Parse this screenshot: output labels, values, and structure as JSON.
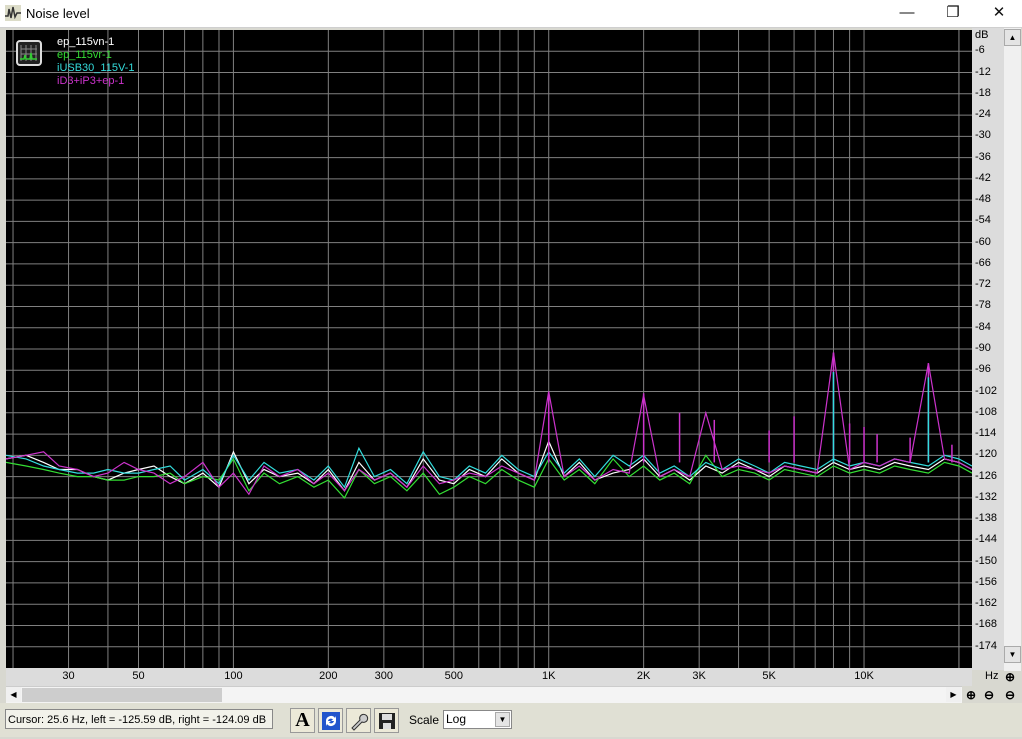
{
  "window": {
    "title": "Noise level",
    "icon": "waveform-app-icon",
    "minimize": "—",
    "restore": "❐",
    "close": "✕"
  },
  "legend": [
    {
      "name": "ep_115vn-1",
      "color": "#ffffff"
    },
    {
      "name": "ep_115vr-1",
      "color": "#33dd33"
    },
    {
      "name": "iUSB30_115V-1",
      "color": "#33dddd"
    },
    {
      "name": "iD3+iP3+ep-1",
      "color": "#cc33cc"
    }
  ],
  "chart_data": {
    "type": "line",
    "xscale": "log",
    "xlim": [
      19,
      22000
    ],
    "ylim": [
      -180,
      0
    ],
    "grid": true,
    "background": "#000000",
    "grid_color": "#808080",
    "ylabel": "dB",
    "xlabel": "Hz",
    "yticks": [
      -6,
      -12,
      -18,
      -24,
      -30,
      -36,
      -42,
      -48,
      -54,
      -60,
      -66,
      -72,
      -78,
      -84,
      -90,
      -96,
      -102,
      -108,
      -114,
      -120,
      -126,
      -132,
      -138,
      -144,
      -150,
      -156,
      -162,
      -168,
      -174
    ],
    "xticks": [
      {
        "v": 30,
        "label": "30"
      },
      {
        "v": 50,
        "label": "50"
      },
      {
        "v": 100,
        "label": "100"
      },
      {
        "v": 200,
        "label": "200"
      },
      {
        "v": 300,
        "label": "300"
      },
      {
        "v": 500,
        "label": "500"
      },
      {
        "v": 1000,
        "label": "1K"
      },
      {
        "v": 2000,
        "label": "2K"
      },
      {
        "v": 3000,
        "label": "3K"
      },
      {
        "v": 5000,
        "label": "5K"
      },
      {
        "v": 10000,
        "label": "10K"
      }
    ],
    "x": [
      19,
      22,
      25,
      28,
      32,
      36,
      40,
      45,
      50,
      56,
      63,
      70,
      80,
      90,
      100,
      112,
      125,
      140,
      160,
      180,
      200,
      225,
      250,
      280,
      315,
      355,
      400,
      450,
      500,
      560,
      630,
      710,
      800,
      900,
      1000,
      1120,
      1250,
      1400,
      1600,
      1800,
      2000,
      2250,
      2500,
      2800,
      3150,
      3550,
      4000,
      4500,
      5000,
      5600,
      6300,
      7100,
      8000,
      9000,
      10000,
      11200,
      12500,
      14000,
      16000,
      18000,
      20000,
      22000
    ],
    "series": [
      {
        "name": "ep_115vn-1",
        "color": "#ffffff",
        "values": [
          -121,
          -120,
          -122,
          -124,
          -124,
          -126,
          -127,
          -125,
          -124,
          -123,
          -126,
          -128,
          -125,
          -129,
          -119,
          -128,
          -124,
          -126,
          -125,
          -128,
          -124,
          -130,
          -122,
          -127,
          -125,
          -129,
          -121,
          -127,
          -128,
          -124,
          -126,
          -121,
          -125,
          -127,
          -116,
          -126,
          -122,
          -127,
          -125,
          -124,
          -121,
          -126,
          -124,
          -127,
          -123,
          -125,
          -122,
          -124,
          -126,
          -123,
          -124,
          -125,
          -122,
          -124,
          -123,
          -124,
          -122,
          -123,
          -124,
          -121,
          -122,
          -124
        ]
      },
      {
        "name": "ep_115vr-1",
        "color": "#33dd33",
        "values": [
          -122,
          -123,
          -124,
          -125,
          -126,
          -126,
          -127,
          -127,
          -126,
          -126,
          -125,
          -128,
          -126,
          -127,
          -121,
          -130,
          -125,
          -128,
          -126,
          -129,
          -127,
          -132,
          -124,
          -128,
          -126,
          -130,
          -125,
          -131,
          -129,
          -126,
          -128,
          -124,
          -127,
          -129,
          -121,
          -127,
          -124,
          -128,
          -121,
          -126,
          -123,
          -127,
          -125,
          -128,
          -120,
          -126,
          -124,
          -125,
          -127,
          -124,
          -125,
          -126,
          -123,
          -125,
          -124,
          -125,
          -123,
          -124,
          -125,
          -122,
          -123,
          -125
        ]
      },
      {
        "name": "iUSB30_115V-1",
        "color": "#33dddd",
        "values": [
          -120,
          -121,
          -123,
          -124,
          -125,
          -125,
          -124,
          -125,
          -125,
          -124,
          -123,
          -127,
          -124,
          -128,
          -120,
          -127,
          -122,
          -125,
          -124,
          -127,
          -123,
          -129,
          -118,
          -126,
          -124,
          -128,
          -119,
          -126,
          -127,
          -123,
          -125,
          -120,
          -124,
          -126,
          -119,
          -125,
          -121,
          -126,
          -120,
          -123,
          -120,
          -125,
          -123,
          -126,
          -122,
          -124,
          -121,
          -123,
          -125,
          -122,
          -123,
          -124,
          -121,
          -123,
          -122,
          -123,
          -121,
          -122,
          -123,
          -120,
          -121,
          -123
        ]
      },
      {
        "name": "iD3+iP3+ep-1",
        "color": "#cc33cc",
        "values": [
          -121,
          -120,
          -119,
          -123,
          -124,
          -126,
          -125,
          -122,
          -124,
          -125,
          -128,
          -126,
          -122,
          -129,
          -125,
          -131,
          -123,
          -126,
          -124,
          -128,
          -125,
          -130,
          -124,
          -127,
          -125,
          -129,
          -123,
          -128,
          -127,
          -125,
          -126,
          -123,
          -125,
          -127,
          -102,
          -126,
          -123,
          -127,
          -124,
          -125,
          -103,
          -126,
          -124,
          -126,
          -108,
          -124,
          -123,
          -124,
          -125,
          -123,
          -124,
          -125,
          -91,
          -124,
          -122,
          -123,
          -121,
          -122,
          -94,
          -121,
          -122,
          -124
        ]
      }
    ],
    "spikes": [
      {
        "series": "iD3+iP3+ep-1",
        "x": 1000,
        "y": -102
      },
      {
        "series": "iD3+iP3+ep-1",
        "x": 2000,
        "y": -102.5
      },
      {
        "series": "iD3+iP3+ep-1",
        "x": 2600,
        "y": -108
      },
      {
        "series": "iD3+iP3+ep-1",
        "x": 3350,
        "y": -110
      },
      {
        "series": "iD3+iP3+ep-1",
        "x": 5000,
        "y": -113
      },
      {
        "series": "iD3+iP3+ep-1",
        "x": 6000,
        "y": -109
      },
      {
        "series": "iD3+iP3+ep-1",
        "x": 8000,
        "y": -91
      },
      {
        "series": "iUSB30_115V-1",
        "x": 8000,
        "y": -96.5
      },
      {
        "series": "iD3+iP3+ep-1",
        "x": 9000,
        "y": -111
      },
      {
        "series": "iD3+iP3+ep-1",
        "x": 10000,
        "y": -112
      },
      {
        "series": "iD3+iP3+ep-1",
        "x": 11000,
        "y": -114
      },
      {
        "series": "iD3+iP3+ep-1",
        "x": 14000,
        "y": -115
      },
      {
        "series": "iD3+iP3+ep-1",
        "x": 16000,
        "y": -94
      },
      {
        "series": "iUSB30_115V-1",
        "x": 16000,
        "y": -98
      },
      {
        "series": "iD3+iP3+ep-1",
        "x": 19000,
        "y": -117
      }
    ]
  },
  "bottom": {
    "status": "Cursor:  25.6 Hz,  left = -125.59 dB,  right = -124.09 dB",
    "font_button": "A",
    "refresh_icon": "refresh-icon",
    "settings_icon": "wrench-icon",
    "save_icon": "floppy-disk-icon",
    "scale_label": "Scale",
    "scale_value": "Log"
  },
  "controls": {
    "zoom_in": "⊕",
    "zoom_out": "⊖",
    "scroll_up": "▲",
    "scroll_down": "▼",
    "scroll_left": "◀",
    "scroll_right": "▶"
  }
}
